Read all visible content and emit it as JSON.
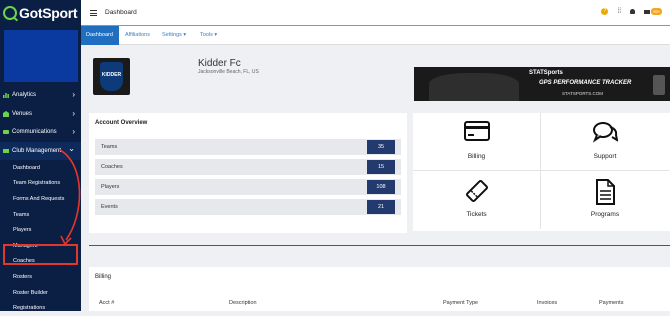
{
  "app": {
    "logo_text": "GotSport"
  },
  "sidebar": {
    "items": [
      {
        "label": "Analytics",
        "chevron": "›"
      },
      {
        "label": "Venues",
        "chevron": "›"
      },
      {
        "label": "Communications",
        "chevron": "›"
      },
      {
        "label": "Club Management",
        "chevron": "⌄"
      }
    ],
    "sub_items": [
      {
        "label": "Dashboard"
      },
      {
        "label": "Team Registrations"
      },
      {
        "label": "Forms And Requests"
      },
      {
        "label": "Teams"
      },
      {
        "label": "Players"
      },
      {
        "label": "Managers"
      },
      {
        "label": "Coaches"
      },
      {
        "label": "Rosters"
      },
      {
        "label": "Roster Builder"
      },
      {
        "label": "Registrations"
      }
    ],
    "highlighted": "Coaches"
  },
  "topbar": {
    "title": "Dashboard",
    "help": "?",
    "mail_badge": "99+"
  },
  "tabs": [
    {
      "label": "Dashboard"
    },
    {
      "label": "Affiliations"
    },
    {
      "label": "Settings ▾"
    },
    {
      "label": "Tools ▾"
    }
  ],
  "club": {
    "name": "Kidder Fc",
    "location": "Jacksonville Beach, FL, US",
    "logo_text": "KIDDER"
  },
  "ad": {
    "brand": "STATSports",
    "tagline": "GPS PERFORMANCE TRACKER",
    "url": "STATSPORTS.COM"
  },
  "account_overview": {
    "title": "Account Overview",
    "rows": [
      {
        "label": "Teams",
        "value": "35"
      },
      {
        "label": "Coaches",
        "value": "15"
      },
      {
        "label": "Players",
        "value": "108"
      },
      {
        "label": "Events",
        "value": "21"
      }
    ]
  },
  "tiles": [
    {
      "label": "Billing",
      "icon": "credit-card-icon"
    },
    {
      "label": "Support",
      "icon": "chat-icon"
    },
    {
      "label": "Tickets",
      "icon": "ticket-icon"
    },
    {
      "label": "Programs",
      "icon": "document-icon"
    }
  ],
  "billing": {
    "title": "Billing",
    "columns": [
      "Acct #",
      "Description",
      "Payment Type",
      "Invoices",
      "Payments"
    ]
  },
  "colors": {
    "sidebar_bg": "#0b1f45",
    "accent_blue": "#1f6ebf",
    "count_badge": "#233a6e",
    "highlight_red": "#e5362b",
    "brand_green": "#6bd44a"
  }
}
